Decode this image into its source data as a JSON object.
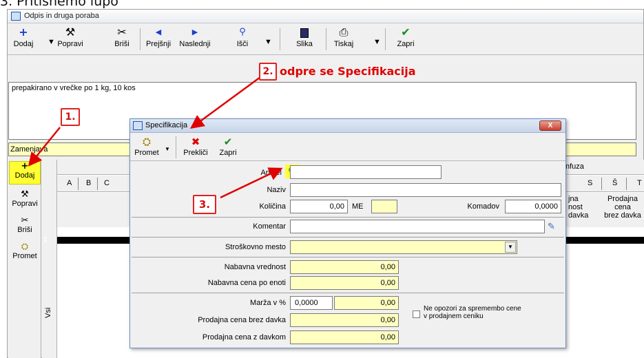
{
  "doc_heading": "3. Pritisnemo lupo",
  "main_window": {
    "title": "Odpis in druga poraba",
    "toolbar": [
      {
        "label": "Dodaj",
        "icon": "plus-icon"
      },
      {
        "label": "Popravi",
        "icon": "hammer-icon"
      },
      {
        "label": "Briši",
        "icon": "scissors-icon"
      },
      {
        "label": "Prejšnji",
        "icon": "arrow-left-icon"
      },
      {
        "label": "Naslednji",
        "icon": "arrow-right-icon"
      },
      {
        "label": "Išči",
        "icon": "magnifier-icon"
      },
      {
        "label": "Slika",
        "icon": "picture-icon"
      },
      {
        "label": "Tiskaj",
        "icon": "printer-icon"
      },
      {
        "label": "Zapri",
        "icon": "checkmark-icon"
      }
    ],
    "memo_text": "prepakirano v vrečke po 1 kg, 10 kos",
    "type_value": "Zamenjava",
    "sidebar": [
      {
        "label": "Dodaj",
        "icon": "plus-icon"
      },
      {
        "label": "Popravi",
        "icon": "hammer-icon"
      },
      {
        "label": "Briši",
        "icon": "scissors-icon"
      },
      {
        "label": "Promet",
        "icon": "promet-icon"
      }
    ],
    "grid": {
      "group_header": "nfuza",
      "columns_left": [
        "A",
        "B",
        "C"
      ],
      "columns_right": [
        "S",
        "Š",
        "T"
      ],
      "col_r_header": "jna\nnost\ndavka",
      "col_s_header": "Prodajna\ncena\nbrez davka",
      "row_number": "1",
      "side_label": "Vsi"
    }
  },
  "dialog": {
    "title": "Specifikacija",
    "close_label": "X",
    "toolbar": [
      {
        "label": "Promet",
        "icon": "promet-icon"
      },
      {
        "label": "Prekliči",
        "icon": "red-x-icon"
      },
      {
        "label": "Zapri",
        "icon": "checkmark-icon"
      }
    ],
    "fields": {
      "artikel_label": "Artikel",
      "artikel_value": "",
      "naziv_label": "Naziv",
      "naziv_value": "",
      "kolicina_label": "Količina",
      "kolicina_value": "0,00",
      "me_label": "ME",
      "me_value": "",
      "komadov_label": "Komadov",
      "komadov_value": "0,0000",
      "komentar_label": "Komentar",
      "komentar_value": "",
      "stroskovno_label": "Stroškovno mesto",
      "stroskovno_value": "",
      "nab_vrednost_label": "Nabavna vrednost",
      "nab_vrednost_value": "0,00",
      "nab_cena_label": "Nabavna cena po enoti",
      "nab_cena_value": "0,00",
      "marza_label": "Marža v %",
      "marza_pct": "0,0000",
      "marza_value": "0,00",
      "prod_brez_label": "Prodajna cena brez davka",
      "prod_brez_value": "0,00",
      "prod_z_label": "Prodajna cena z davkom",
      "prod_z_value": "0,00",
      "opozori_label": "Ne opozori za spremembo cene\nv prodajnem ceniku"
    }
  },
  "annotations": {
    "step1": "1.",
    "step2_num": "2.",
    "step2_text": "odpre se Specifikacija",
    "step3": "3.",
    "accent_red": "#e00000"
  }
}
